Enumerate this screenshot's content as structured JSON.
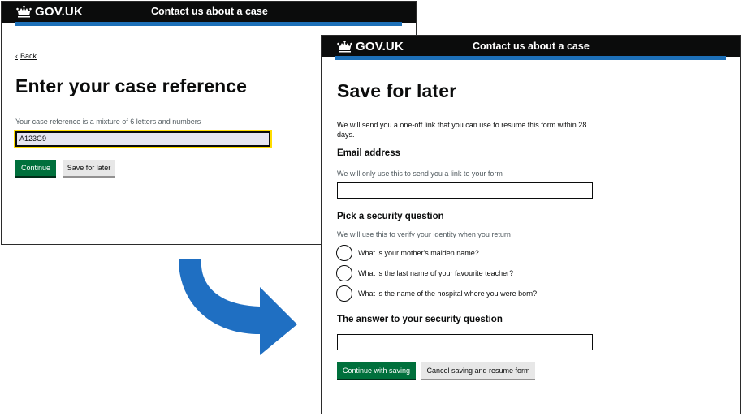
{
  "colors": {
    "header_bg": "#0b0c0c",
    "header_blue": "#1d70b8",
    "primary_button": "#00703c",
    "focus_yellow": "#ffdd00",
    "arrow_blue": "#1f6fc2"
  },
  "screen1": {
    "header": {
      "logo_text": "GOV.UK",
      "service_name": "Contact us about a case"
    },
    "back_link": "Back",
    "heading": "Enter your case reference",
    "hint": "Your case reference is a mixture of 6 letters and numbers",
    "case_input_value": "A123G9",
    "continue_label": "Continue",
    "save_later_label": "Save for later"
  },
  "arrow_icon": "curved-arrow-right",
  "screen2": {
    "header": {
      "logo_text": "GOV.UK",
      "service_name": "Contact us about a case"
    },
    "heading": "Save for later",
    "intro_line1": "We will send you a one-off link that you can use to resume this form within 28",
    "intro_line2": "days.",
    "email_label": "Email address",
    "email_hint": "We will only use this to send you a link to your form",
    "email_value": "",
    "security_label": "Pick a security question",
    "security_hint": "We will use this to verify your identity when you return",
    "questions": [
      "What is your mother's maiden name?",
      "What is the last name of your favourite teacher?",
      "What is the name of the hospital where you were born?"
    ],
    "answer_label": "The answer to your security question",
    "answer_value": "",
    "continue_saving_label": "Continue with saving",
    "cancel_label": "Cancel saving and resume form"
  }
}
